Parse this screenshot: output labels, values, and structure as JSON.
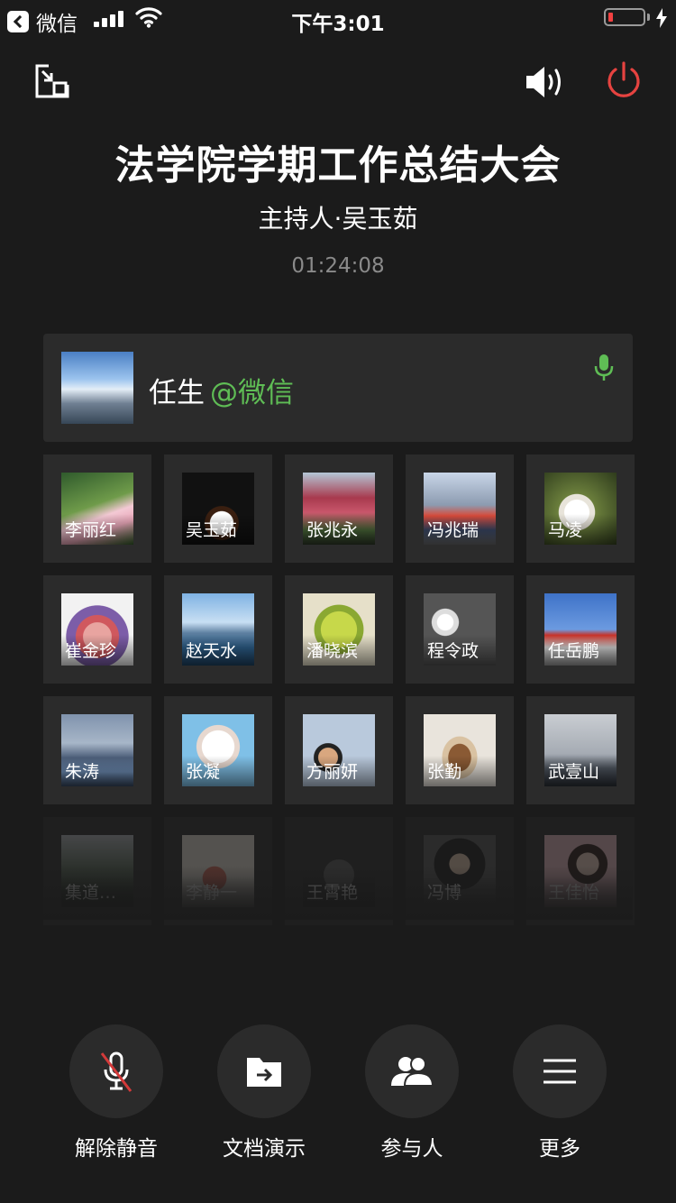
{
  "status_bar": {
    "back_app_label": "微信",
    "time": "下午3:01",
    "battery_level": 0.15
  },
  "meeting": {
    "title": "法学院学期工作总结大会",
    "host": "主持人·吴玉茹",
    "duration": "01:24:08"
  },
  "active_speaker": {
    "name": "任生",
    "org": "@微信",
    "mic": "on"
  },
  "participants": [
    {
      "name": "李丽红",
      "photo": "lotus"
    },
    {
      "name": "吴玉茹",
      "photo": "coffee"
    },
    {
      "name": "张兆永",
      "photo": "flowers-tree"
    },
    {
      "name": "冯兆瑞",
      "photo": "street-photo"
    },
    {
      "name": "马凌",
      "photo": "magnolia"
    },
    {
      "name": "崔金珍",
      "photo": "bouquet"
    },
    {
      "name": "赵天水",
      "photo": "sea"
    },
    {
      "name": "潘晓滨",
      "photo": "leaf"
    },
    {
      "name": "程令政",
      "photo": "blossoms"
    },
    {
      "name": "任岳鹏",
      "photo": "red-leaf"
    },
    {
      "name": "朱涛",
      "photo": "lake"
    },
    {
      "name": "张凝",
      "photo": "puppy"
    },
    {
      "name": "方丽妍",
      "photo": "tower-selfie"
    },
    {
      "name": "张勤",
      "photo": "chipmunk"
    },
    {
      "name": "武壹山",
      "photo": "foggy-hill"
    },
    {
      "name": "集道…",
      "photo": "trees"
    },
    {
      "name": "李静一",
      "photo": "deer"
    },
    {
      "name": "王霄艳",
      "photo": "cat"
    },
    {
      "name": "冯博",
      "photo": "portrait"
    },
    {
      "name": "王佳怡",
      "photo": "girl"
    }
  ],
  "actions": [
    {
      "label": "解除静音",
      "icon": "mic-muted-icon"
    },
    {
      "label": "文档演示",
      "icon": "document-share-icon"
    },
    {
      "label": "参与人",
      "icon": "participants-icon"
    },
    {
      "label": "更多",
      "icon": "menu-icon"
    }
  ],
  "colors": {
    "background": "#1b1b1b",
    "card": "#2b2b2b",
    "accent_green": "#5fbd55",
    "power_red": "#e64340",
    "mute_slash": "#d33a3a"
  }
}
